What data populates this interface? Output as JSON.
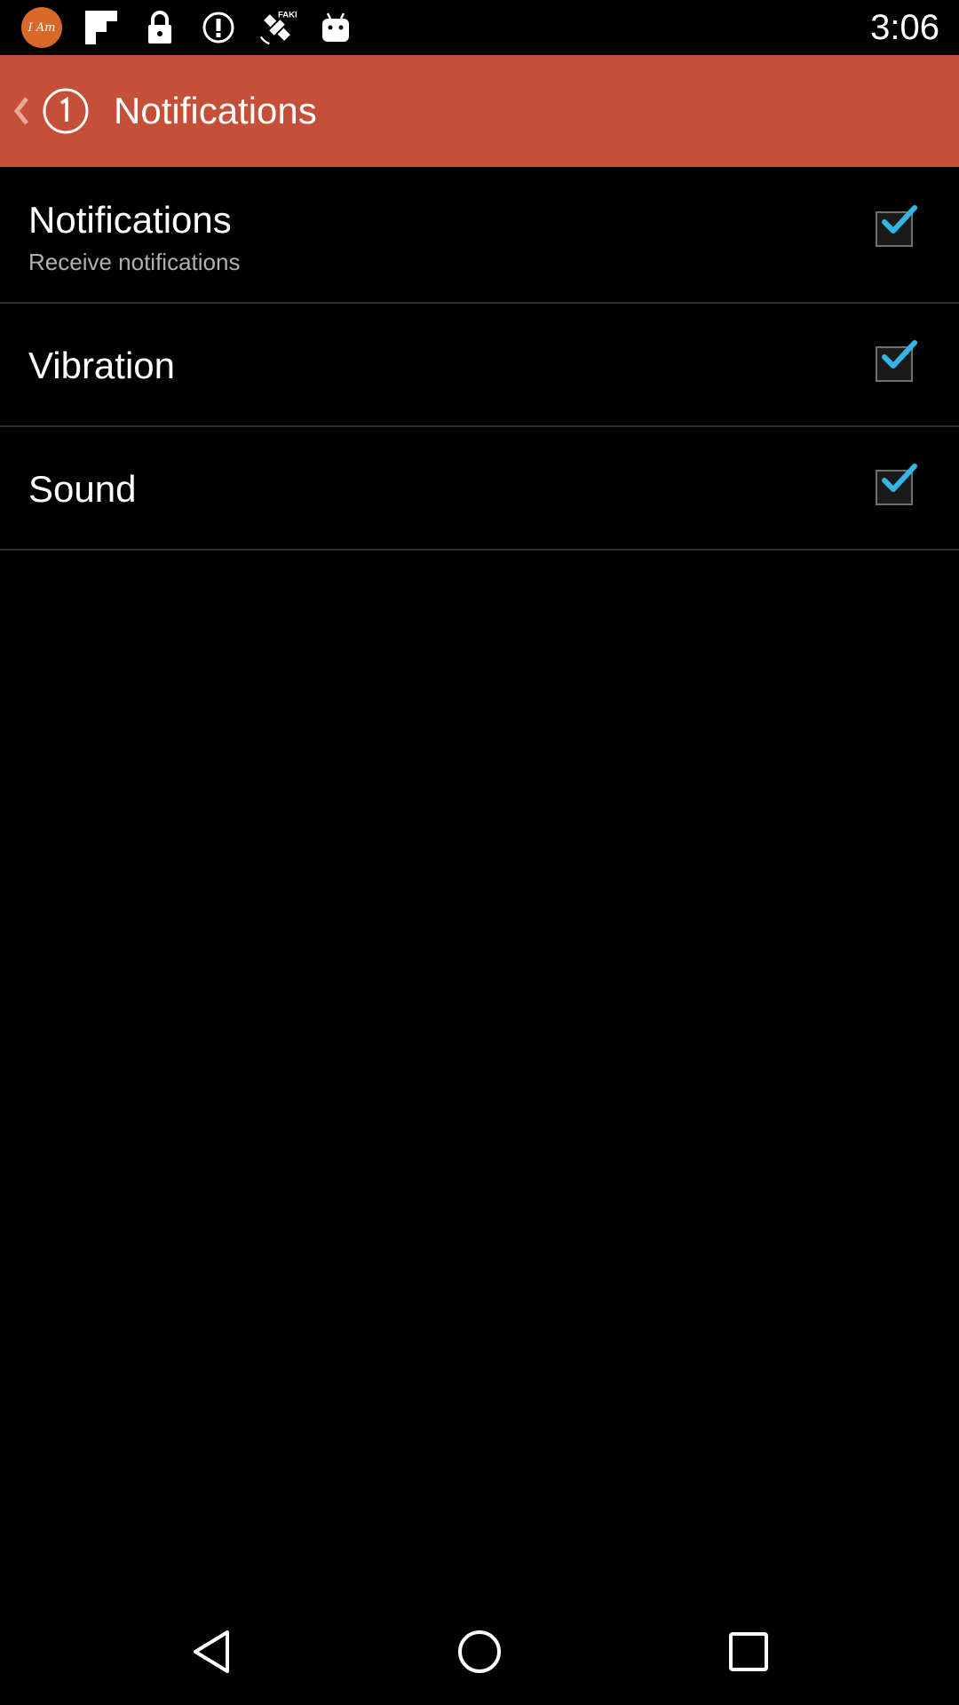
{
  "status_bar": {
    "time": "3:06",
    "app_badge_text": "I Am",
    "icons": [
      "app-badge-icon",
      "flipboard-icon",
      "lock-icon",
      "alert-icon",
      "fake-gps-satellite-icon",
      "android-icon"
    ]
  },
  "action_bar": {
    "title": "Notifications",
    "color": "#c65037"
  },
  "preferences": [
    {
      "title": "Notifications",
      "summary": "Receive notifications",
      "checked": true
    },
    {
      "title": "Vibration",
      "checked": true
    },
    {
      "title": "Sound",
      "checked": true
    }
  ],
  "colors": {
    "check_blue": "#33b5e5",
    "background": "#000000"
  },
  "nav_bar": {
    "icons": [
      "back-icon",
      "home-icon",
      "recents-icon"
    ]
  }
}
